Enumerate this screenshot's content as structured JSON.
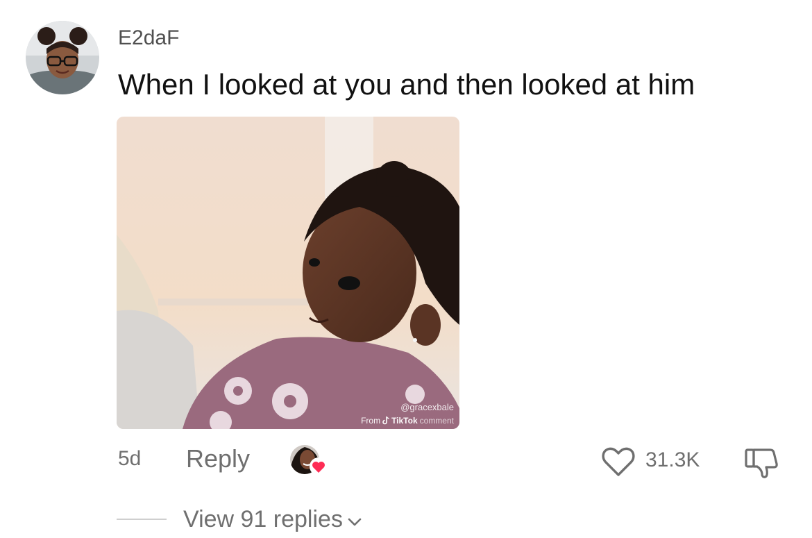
{
  "comment": {
    "username": "E2daF",
    "text": "When I looked at you and then looked at him",
    "age": "5d",
    "reply_label": "Reply",
    "like_count": "31.3K",
    "replies_label": "View 91 replies"
  },
  "media": {
    "watermark_handle": "@gracexbale",
    "watermark_from": "From",
    "watermark_brand": "TikTok",
    "watermark_note": "comment"
  },
  "colors": {
    "heart_badge": "#fe2c55",
    "secondary_text": "#6f6f6f"
  }
}
